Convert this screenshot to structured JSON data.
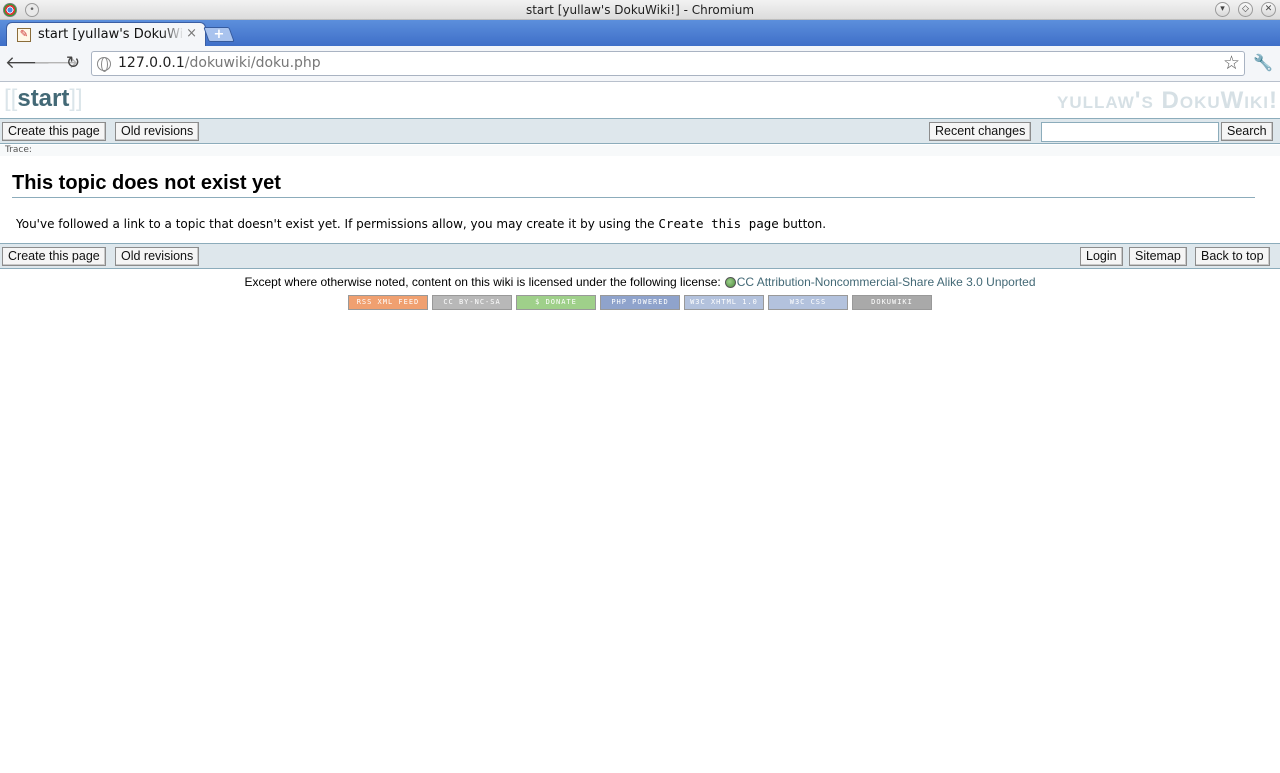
{
  "window": {
    "title": "start [yullaw's DokuWiki!] - Chromium"
  },
  "tab": {
    "label": "start [yullaw's DokuWiki!]",
    "close": "×",
    "new_tab": "+"
  },
  "toolbar": {
    "url_host": "127.0.0.1",
    "url_path": "/dokuwiki/doku.php"
  },
  "wiki": {
    "pagename": "start",
    "bracket_open": "[[",
    "bracket_close": "]]",
    "logo": "yullaw's DokuWiki!",
    "top_bar": {
      "create_page": "Create this page",
      "old_revisions": "Old revisions",
      "recent_changes": "Recent changes",
      "search_value": "",
      "search_button": "Search"
    },
    "trace_label": "Trace:",
    "heading": "This topic does not exist yet",
    "message_before": "You've followed a link to a topic that doesn't exist yet. If permissions allow, you may create it by using the",
    "message_code": "Create this page",
    "message_after": "button.",
    "bottom_bar": {
      "create_page": "Create this page",
      "old_revisions": "Old revisions",
      "login": "Login",
      "sitemap": "Sitemap",
      "back_to_top": "Back to top"
    },
    "license_text": "Except where otherwise noted, content on this wiki is licensed under the following license:",
    "license_link": "CC Attribution-Noncommercial-Share Alike 3.0 Unported",
    "badges": [
      {
        "label": "RSS XML FEED",
        "color": "#f0a070"
      },
      {
        "label": "CC BY-NC-SA",
        "color": "#b8b8b8"
      },
      {
        "label": "$ DONATE",
        "color": "#9fd08a"
      },
      {
        "label": "PHP POWERED",
        "color": "#8fa3cc"
      },
      {
        "label": "W3C XHTML 1.0",
        "color": "#b3c2dd"
      },
      {
        "label": "W3C CSS",
        "color": "#b3c2dd"
      },
      {
        "label": "DOKUWIKI",
        "color": "#a9a9a9"
      }
    ]
  }
}
